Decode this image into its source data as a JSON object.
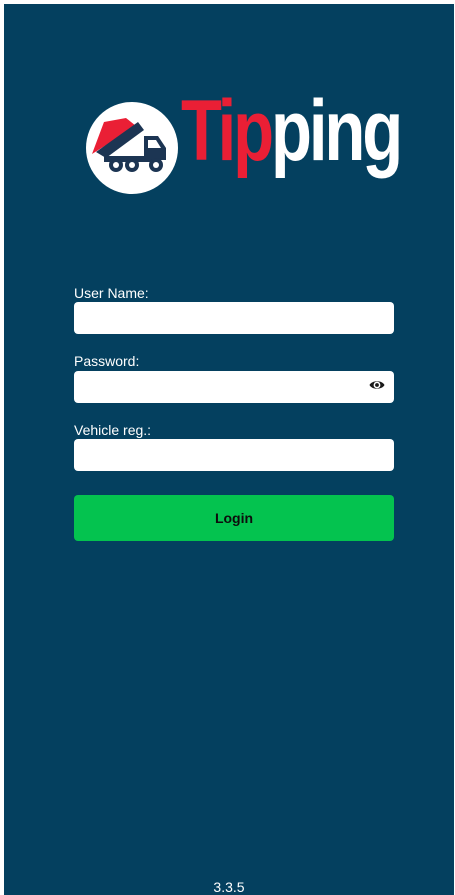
{
  "app": {
    "logo_text_red": "Tip",
    "logo_text_white": "ping",
    "logo_icon": "dump-truck-icon",
    "background_color": "#04405f",
    "brand_red": "#ea1f35",
    "accent_green": "#04c34f"
  },
  "form": {
    "username": {
      "label": "User Name:",
      "value": "",
      "placeholder": ""
    },
    "password": {
      "label": "Password:",
      "value": "",
      "placeholder": "",
      "toggle_icon": "eye-icon"
    },
    "vehicle": {
      "label": "Vehicle reg.:",
      "value": "",
      "placeholder": ""
    },
    "login_label": "Login"
  },
  "footer": {
    "version": "3.3.5"
  }
}
